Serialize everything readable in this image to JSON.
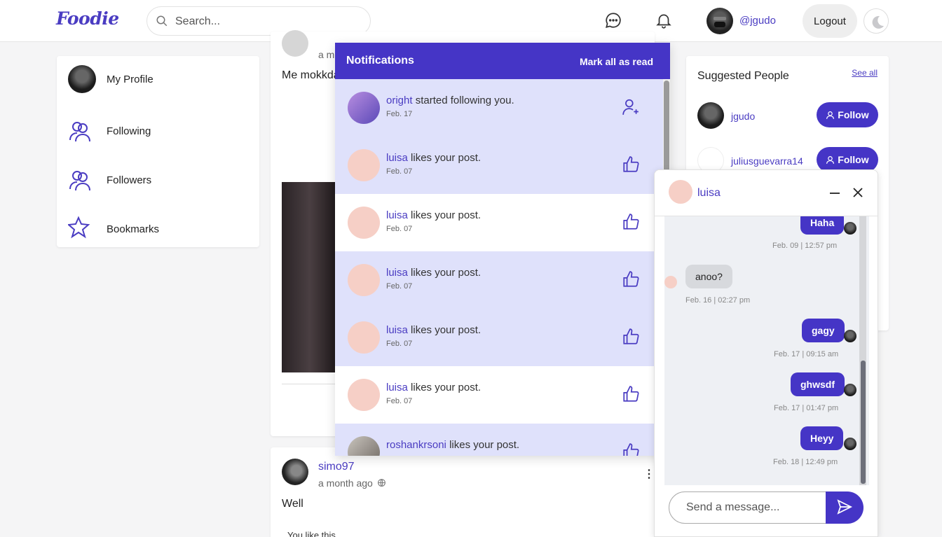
{
  "header": {
    "logo": "Foodie",
    "search_placeholder": "Search...",
    "handle": "@jgudo",
    "logout_label": "Logout"
  },
  "sidebar": {
    "items": [
      {
        "label": "My Profile",
        "icon": "avatar"
      },
      {
        "label": "Following",
        "icon": "users-icon"
      },
      {
        "label": "Followers",
        "icon": "users-icon"
      },
      {
        "label": "Bookmarks",
        "icon": "star-icon"
      }
    ]
  },
  "feed": {
    "post1": {
      "time_partial": "a m",
      "text_partial": "Me mokkda"
    },
    "post2": {
      "author": "simo97",
      "time": "a month ago",
      "text": "Well",
      "likes_text": "You like this"
    }
  },
  "notifications": {
    "title": "Notifications",
    "mark_all": "Mark all as read",
    "items": [
      {
        "user": "oright",
        "action": "started following you.",
        "date": "Feb. 17",
        "icon": "user-plus-icon",
        "unread": true
      },
      {
        "user": "luisa",
        "action": "likes your post.",
        "date": "Feb. 07",
        "icon": "thumbs-up-icon",
        "unread": true
      },
      {
        "user": "luisa",
        "action": "likes your post.",
        "date": "Feb. 07",
        "icon": "thumbs-up-icon",
        "unread": false
      },
      {
        "user": "luisa",
        "action": "likes your post.",
        "date": "Feb. 07",
        "icon": "thumbs-up-icon",
        "unread": true
      },
      {
        "user": "luisa",
        "action": "likes your post.",
        "date": "Feb. 07",
        "icon": "thumbs-up-icon",
        "unread": true
      },
      {
        "user": "luisa",
        "action": "likes your post.",
        "date": "Feb. 07",
        "icon": "thumbs-up-icon",
        "unread": false
      },
      {
        "user": "roshankrsoni",
        "action": "likes your post.",
        "date": "",
        "icon": "thumbs-up-icon",
        "unread": true
      }
    ]
  },
  "suggested": {
    "title": "Suggested People",
    "see_all": "See all",
    "people": [
      {
        "name": "jgudo",
        "button": "Follow"
      },
      {
        "name": "juliusguevarra14",
        "button": "Follow"
      }
    ]
  },
  "chat": {
    "name": "luisa",
    "messages": [
      {
        "from": "me",
        "text": "Haha",
        "time": "Feb. 09 | 12:57 pm"
      },
      {
        "from": "them",
        "text": "anoo?",
        "time": "Feb. 16 | 02:27 pm"
      },
      {
        "from": "me",
        "text": "gagy",
        "time": "Feb. 17 | 09:15 am"
      },
      {
        "from": "me",
        "text": "ghwsdf",
        "time": "Feb. 17 | 01:47 pm"
      },
      {
        "from": "me",
        "text": "Heyy",
        "time": "Feb. 18 | 12:49 pm"
      }
    ],
    "input_placeholder": "Send a message..."
  },
  "colors": {
    "accent": "#4535c6",
    "unread_bg": "#dfe1fb"
  }
}
